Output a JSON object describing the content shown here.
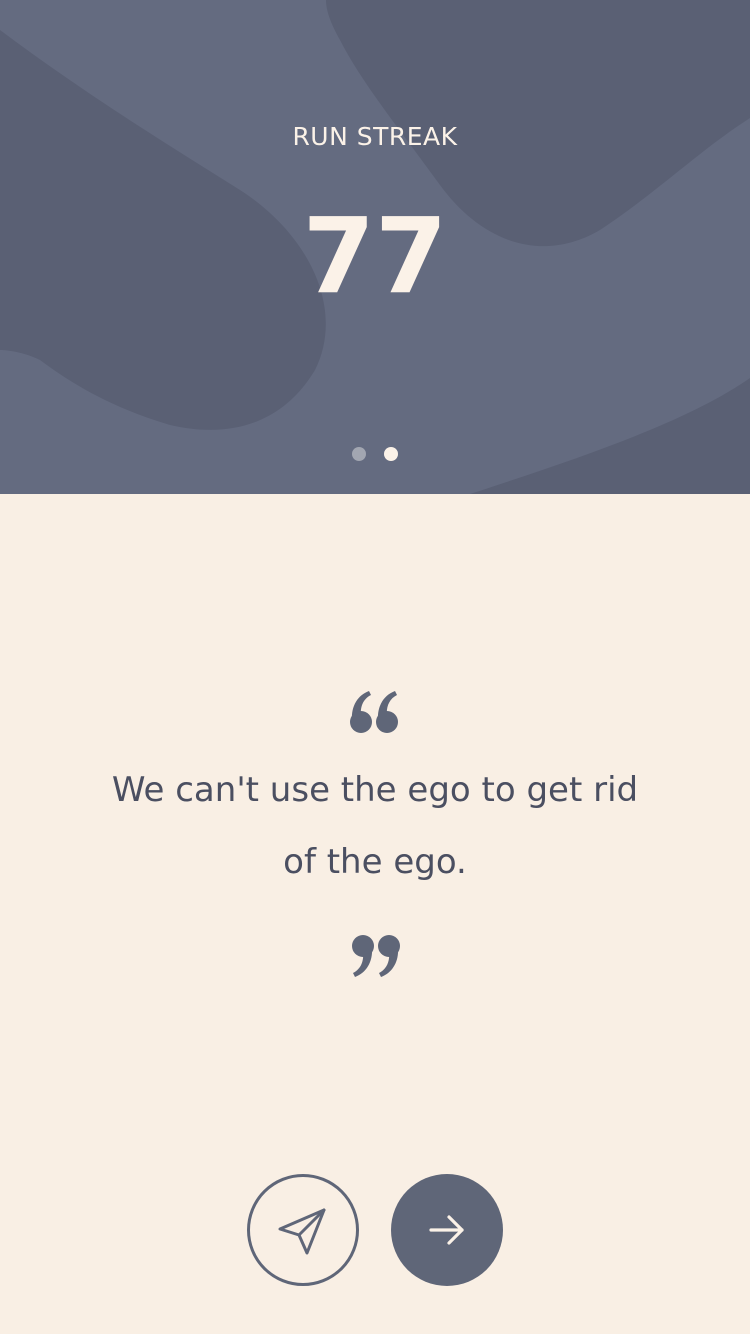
{
  "streak": {
    "label": "RUN STREAK",
    "value": "77"
  },
  "pager": {
    "count": 2,
    "active_index": 1
  },
  "quote": {
    "text": "We can't use the ego to get rid of the ego.",
    "open_icon": "open-quote-icon",
    "close_icon": "close-quote-icon"
  },
  "actions": {
    "share_icon": "paper-plane-icon",
    "next_icon": "arrow-right-icon"
  },
  "colors": {
    "hero_base": "#646b80",
    "hero_blob": "#5a6074",
    "cream": "#f9efe4",
    "text_light": "#fbf2e8",
    "text_dark": "#4b4f61",
    "accent": "#5f6678"
  }
}
